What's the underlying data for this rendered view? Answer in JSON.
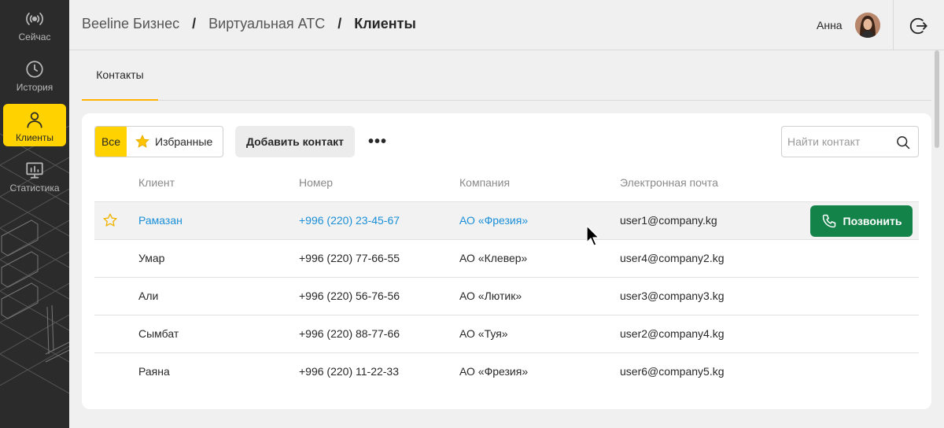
{
  "sidebar": {
    "items": [
      {
        "label": "Сейчас",
        "icon": "broadcast-icon",
        "active": false
      },
      {
        "label": "История",
        "icon": "clock-icon",
        "active": false
      },
      {
        "label": "Клиенты",
        "icon": "user-icon",
        "active": true
      },
      {
        "label": "Статистика",
        "icon": "chart-icon",
        "active": false
      }
    ]
  },
  "header": {
    "breadcrumbs": [
      "Beeline Бизнес",
      "Виртуальная АТС",
      "Клиенты"
    ],
    "separator": "/",
    "user_name": "Анна"
  },
  "tabs": [
    {
      "label": "Контакты",
      "active": true
    }
  ],
  "toolbar": {
    "filter_all": "Все",
    "filter_favorites": "Избранные",
    "add_contact": "Добавить контакт",
    "more": "•••",
    "search_placeholder": "Найти контакт"
  },
  "table": {
    "columns": [
      "Клиент",
      "Номер",
      "Компания",
      "Электронная почта"
    ],
    "rows": [
      {
        "name": "Рамазан",
        "phone": "+996 (220) 23-45-67",
        "company": "АО «Фрезия»",
        "email": "user1@company.kg"
      },
      {
        "name": "Умар",
        "phone": "+996 (220) 77-66-55",
        "company": "АО «Клевер»",
        "email": "user4@company2.kg"
      },
      {
        "name": "Али",
        "phone": "+996 (220) 56-76-56",
        "company": "АО «Лютик»",
        "email": "user3@company3.kg"
      },
      {
        "name": "Сымбат",
        "phone": "+996 (220) 88-77-66",
        "company": "АО «Туя»",
        "email": "user2@company4.kg"
      },
      {
        "name": "Раяна",
        "phone": "+996 (220) 11-22-33",
        "company": "АО «Фрезия»",
        "email": "user6@company5.kg"
      }
    ],
    "call_label": "Позвонить"
  },
  "colors": {
    "accent": "#ffd200",
    "call_green": "#14834a",
    "link_blue": "#1a8fd8",
    "sidebar_bg": "#2b2b2b"
  }
}
